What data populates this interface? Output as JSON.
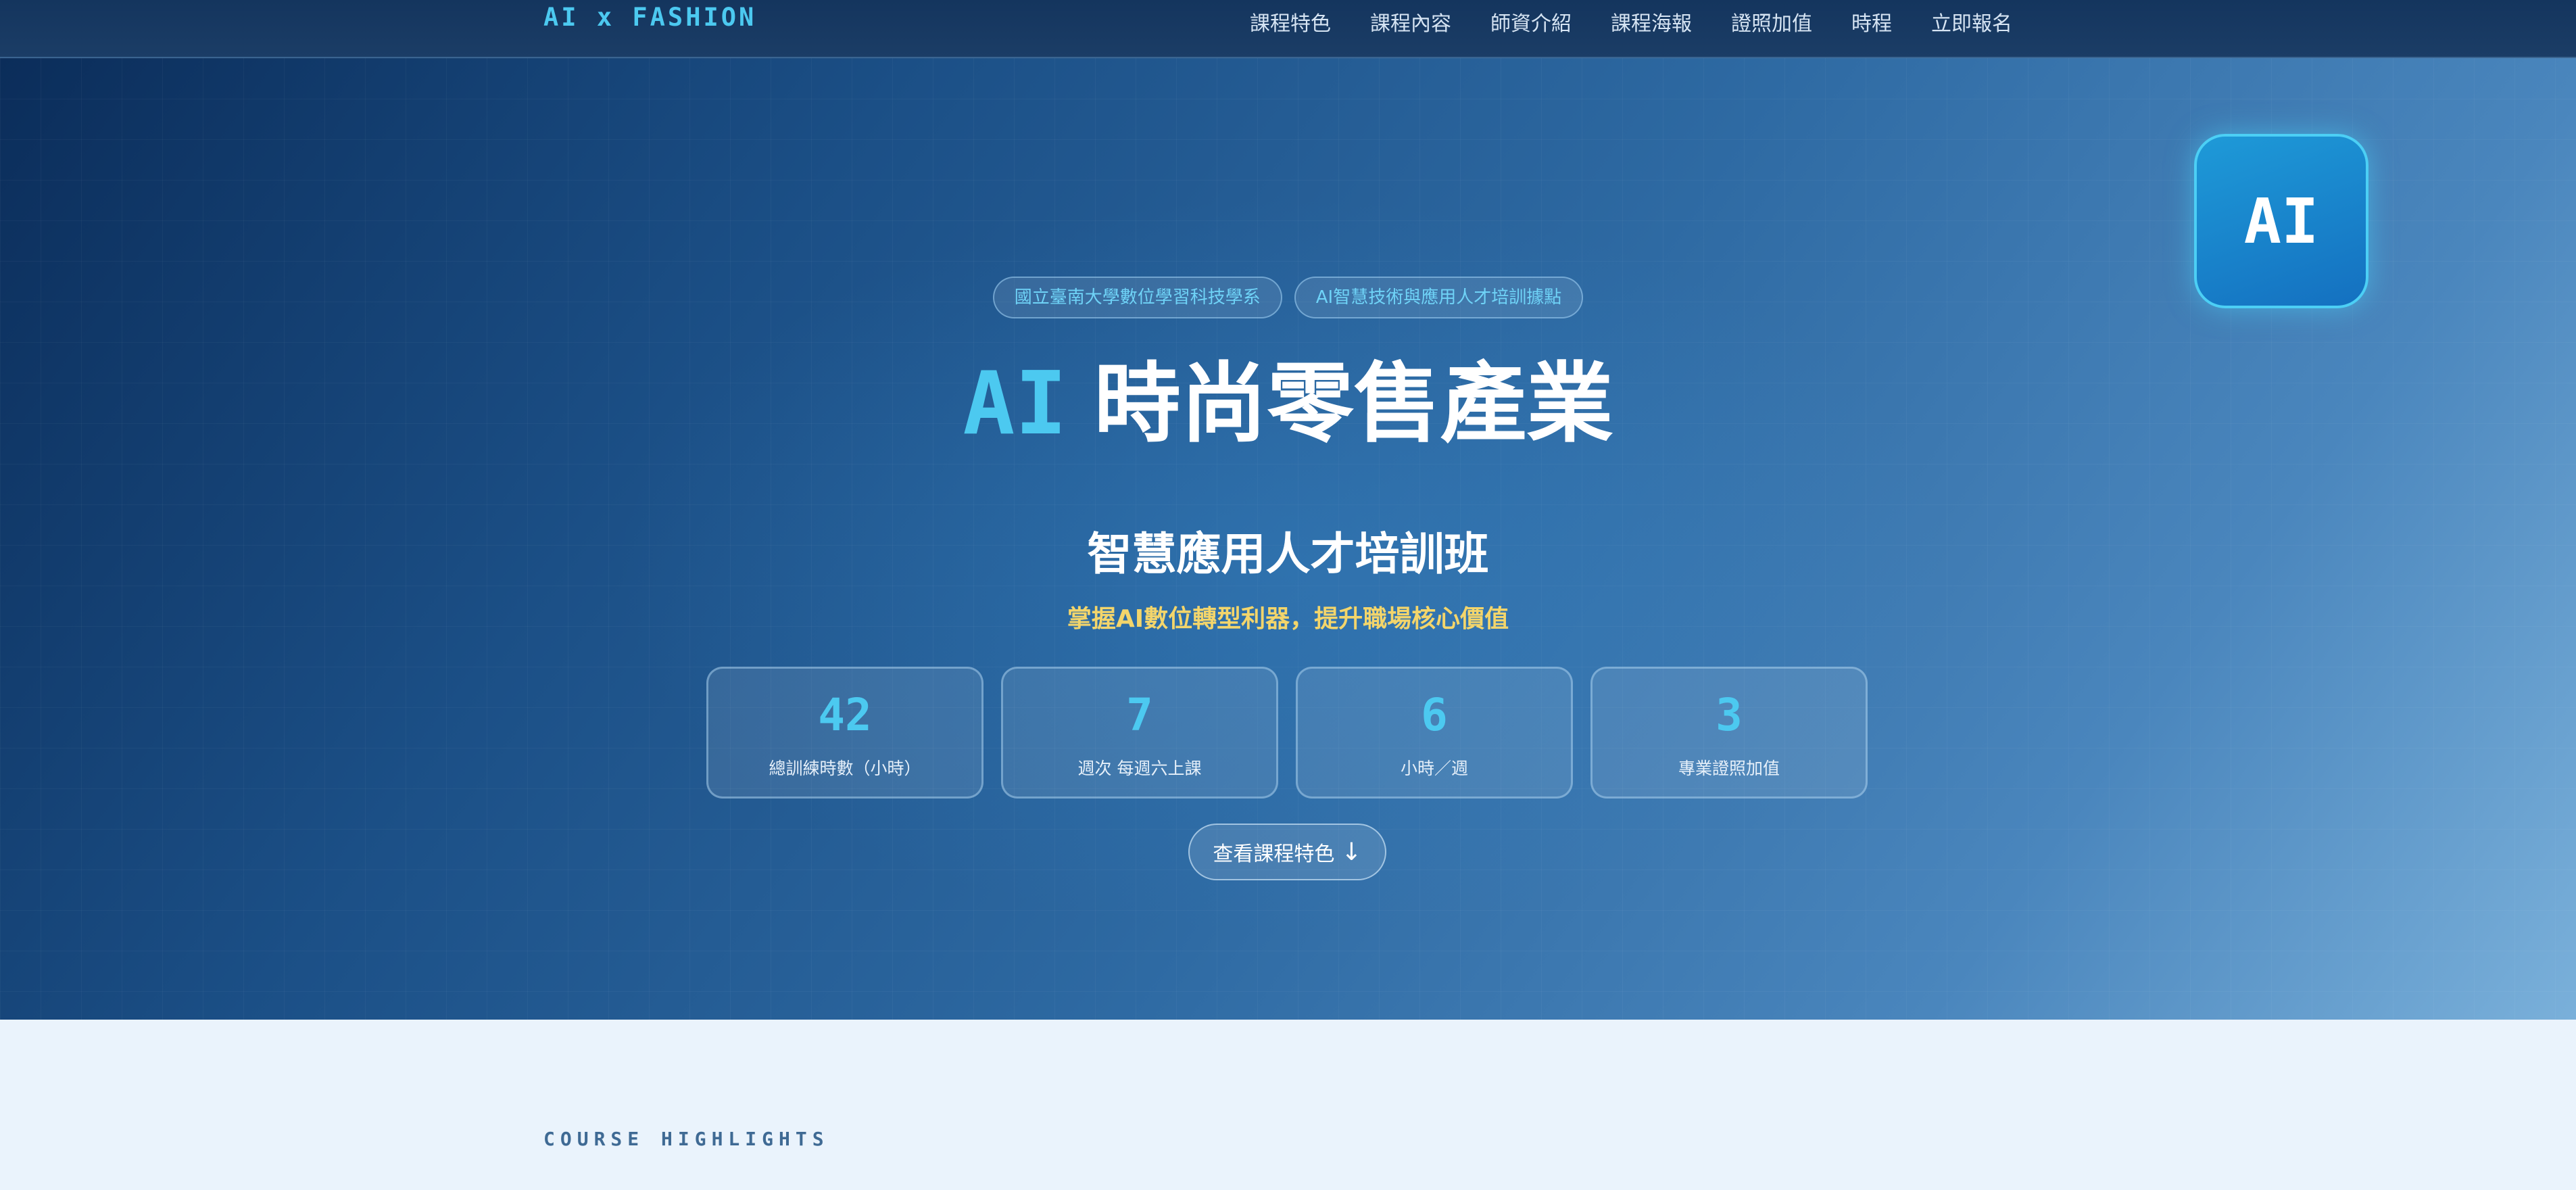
{
  "nav": {
    "brand": "AI x FASHION",
    "links": [
      "課程特色",
      "課程內容",
      "師資介紹",
      "課程海報",
      "證照加值",
      "時程",
      "立即報名"
    ]
  },
  "hero": {
    "badge": "AI",
    "tags": [
      "國立臺南大學數位學習科技學系",
      "AI智慧技術與應用人才培訓據點"
    ],
    "title_accent": "AI",
    "title_main": "時尚零售產業",
    "subtitle": "智慧應用人才培訓班",
    "tagline": "掌握AI數位轉型利器，提升職場核心價值",
    "stats": [
      {
        "value": "42",
        "label": "總訓練時數（小時）"
      },
      {
        "value": "7",
        "label": "週次 每週六上課"
      },
      {
        "value": "6",
        "label": "小時／週"
      },
      {
        "value": "3",
        "label": "專業證照加值"
      }
    ],
    "cta_label": "查看課程特色",
    "cta_arrow": "↓"
  },
  "highlights": {
    "label": "COURSE HIGHLIGHTS"
  },
  "colors": {
    "accent": "#4cc9f0",
    "tagline": "#f3d56b",
    "nav_bg": "#14355e"
  }
}
